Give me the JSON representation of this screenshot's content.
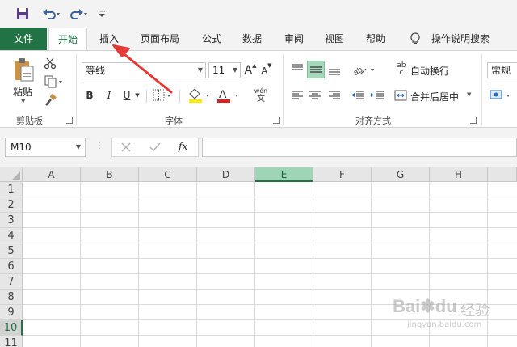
{
  "quick_access": {
    "save_icon": "save-icon",
    "undo_icon": "undo-icon",
    "redo_icon": "redo-icon",
    "customize_icon": "customize-qat-icon"
  },
  "tabs": [
    {
      "label": "文件"
    },
    {
      "label": "开始"
    },
    {
      "label": "插入"
    },
    {
      "label": "页面布局"
    },
    {
      "label": "公式"
    },
    {
      "label": "数据"
    },
    {
      "label": "审阅"
    },
    {
      "label": "视图"
    },
    {
      "label": "帮助"
    }
  ],
  "tell_me": "操作说明搜索",
  "ribbon": {
    "clipboard": {
      "paste_label": "粘贴",
      "group_label": "剪贴板"
    },
    "font": {
      "font_name": "等线",
      "font_size": "11",
      "bold": "B",
      "italic": "I",
      "underline": "U",
      "grow": "A",
      "shrink": "A",
      "font_color": "A",
      "phonetic_top": "wén",
      "phonetic_bottom": "文",
      "group_label": "字体"
    },
    "alignment": {
      "wrap_text": "自动换行",
      "merge_center": "合并后居中",
      "group_label": "对齐方式",
      "ab_label": "ab",
      "c_label": "c"
    },
    "number": {
      "format": "常规"
    }
  },
  "formula_bar": {
    "name_box": "M10",
    "fx": "fx"
  },
  "grid": {
    "columns": [
      "A",
      "B",
      "C",
      "D",
      "E",
      "F",
      "G",
      "H"
    ],
    "rows": [
      "1",
      "2",
      "3",
      "4",
      "5",
      "6",
      "7",
      "8",
      "9",
      "10",
      "11"
    ],
    "selected_column": "E",
    "selected_row": "10"
  },
  "watermark": {
    "brand": "Bai",
    "brand2": "du",
    "cn": "经验",
    "url": "jingyan.baidu.com"
  },
  "colors": {
    "excel_green": "#217346",
    "selected_header": "#9fd5b7",
    "arrow_red": "#e53935"
  }
}
